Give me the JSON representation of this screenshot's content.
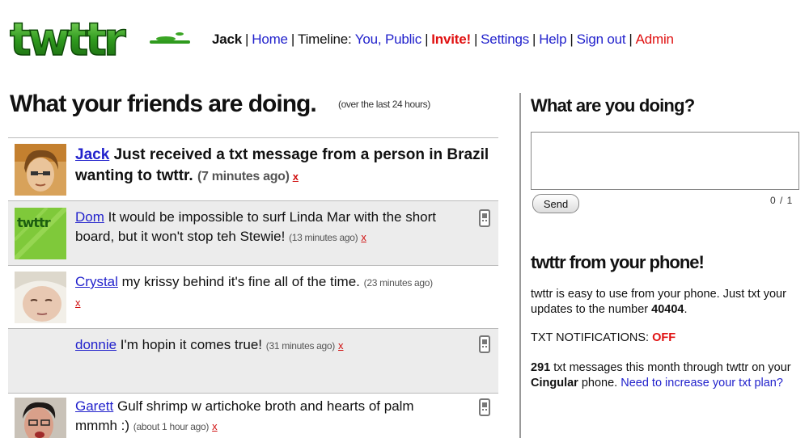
{
  "logo": {
    "text": "twttr"
  },
  "nav": {
    "user": "Jack",
    "home": "Home",
    "timeline_label": "Timeline:",
    "you": "You,",
    "public": "Public",
    "invite": "Invite!",
    "settings": "Settings",
    "help": "Help",
    "signout": "Sign out",
    "admin": "Admin",
    "separator": "|"
  },
  "main": {
    "heading": "What your friends are doing.",
    "heading_note": "(over the last 24 hours)",
    "statuses": [
      {
        "name": "Jack",
        "text": "Just received a txt message from a person in Brazil wanting to twttr.",
        "time": "(7 minutes ago)",
        "delete": "x"
      },
      {
        "name": "Dom",
        "text": "It would be impossible to surf Linda Mar with the short board, but it won't stop teh Stewie!",
        "time": "(13 minutes ago)",
        "delete": "x",
        "avatar_text": "twttr"
      },
      {
        "name": "Crystal",
        "text": "my krissy behind it's fine all of the time.",
        "time": "(23 minutes ago)",
        "delete": "x"
      },
      {
        "name": "donnie",
        "text": "I'm hopin it comes true!",
        "time": "(31 minutes ago)",
        "delete": "x"
      },
      {
        "name": "Garett",
        "text": "Gulf shrimp w artichoke broth and hearts of palm mmmh :)",
        "time": "(about 1 hour ago)",
        "delete": "x"
      }
    ]
  },
  "sidebar": {
    "title": "What are you doing?",
    "send_label": "Send",
    "counter": "0 / 1",
    "phone_title": "twttr from your phone!",
    "phone_desc_1": "twttr is easy to use from your phone. Just txt your updates to the number",
    "phone_number": "40404",
    "phone_desc_end": ".",
    "notif_label": "TXT NOTIFICATIONS:",
    "notif_value": "OFF",
    "msg_count": "291",
    "msg_text_1": "txt messages this month through twttr on your",
    "carrier": "Cingular",
    "msg_text_2": "phone.",
    "increase_link": "Need to increase your txt plan?"
  },
  "colors": {
    "link": "#2222cc",
    "alert": "#e01010",
    "logo_green": "#2f9a1e"
  }
}
